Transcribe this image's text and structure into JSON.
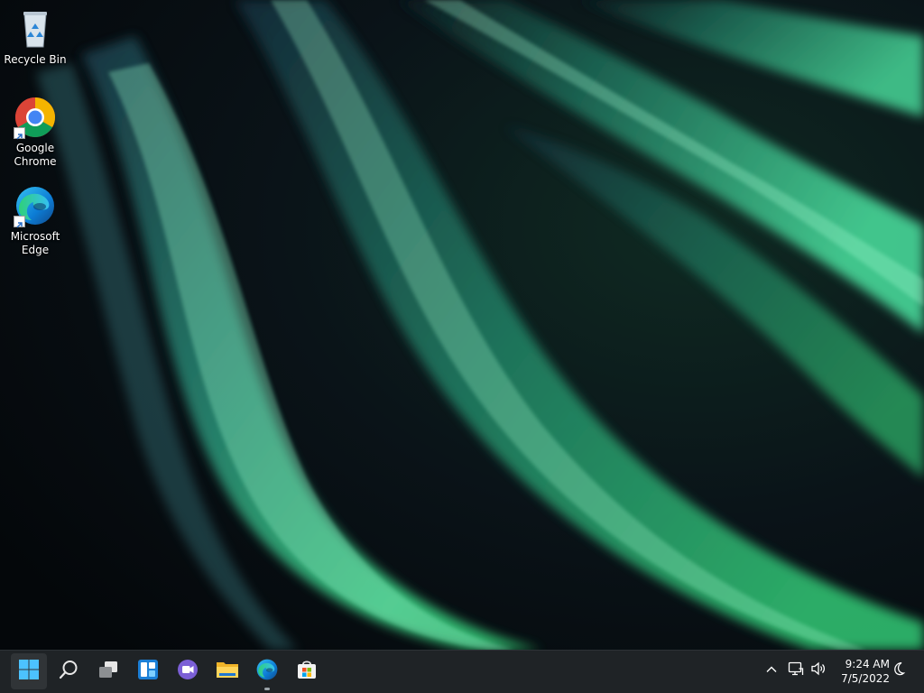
{
  "desktop": {
    "icons": [
      {
        "label": "Recycle Bin",
        "icon": "recycle-bin-icon"
      },
      {
        "label": "Google\nChrome",
        "icon": "chrome-icon",
        "shortcut": true
      },
      {
        "label": "Microsoft\nEdge",
        "icon": "edge-icon",
        "shortcut": true
      }
    ]
  },
  "taskbar": {
    "buttons": [
      {
        "name": "start",
        "icon": "windows-logo-icon"
      },
      {
        "name": "search",
        "icon": "search-icon"
      },
      {
        "name": "task-view",
        "icon": "task-view-icon"
      },
      {
        "name": "widgets",
        "icon": "widgets-icon"
      },
      {
        "name": "chat",
        "icon": "teams-chat-icon"
      },
      {
        "name": "file-explorer",
        "icon": "folder-icon"
      },
      {
        "name": "edge",
        "icon": "edge-icon",
        "running": true
      },
      {
        "name": "store",
        "icon": "store-icon"
      }
    ],
    "tray": {
      "overflow_icon": "chevron-up-icon",
      "network_icon": "network-icon",
      "volume_icon": "volume-icon",
      "focus_icon": "moon-icon"
    },
    "clock": {
      "time": "9:24 AM",
      "date": "7/5/2022"
    }
  },
  "colors": {
    "taskbar_bg": "#1f2326",
    "accent_green": "#3fd98a",
    "wallpaper_dark": "#05080c"
  }
}
